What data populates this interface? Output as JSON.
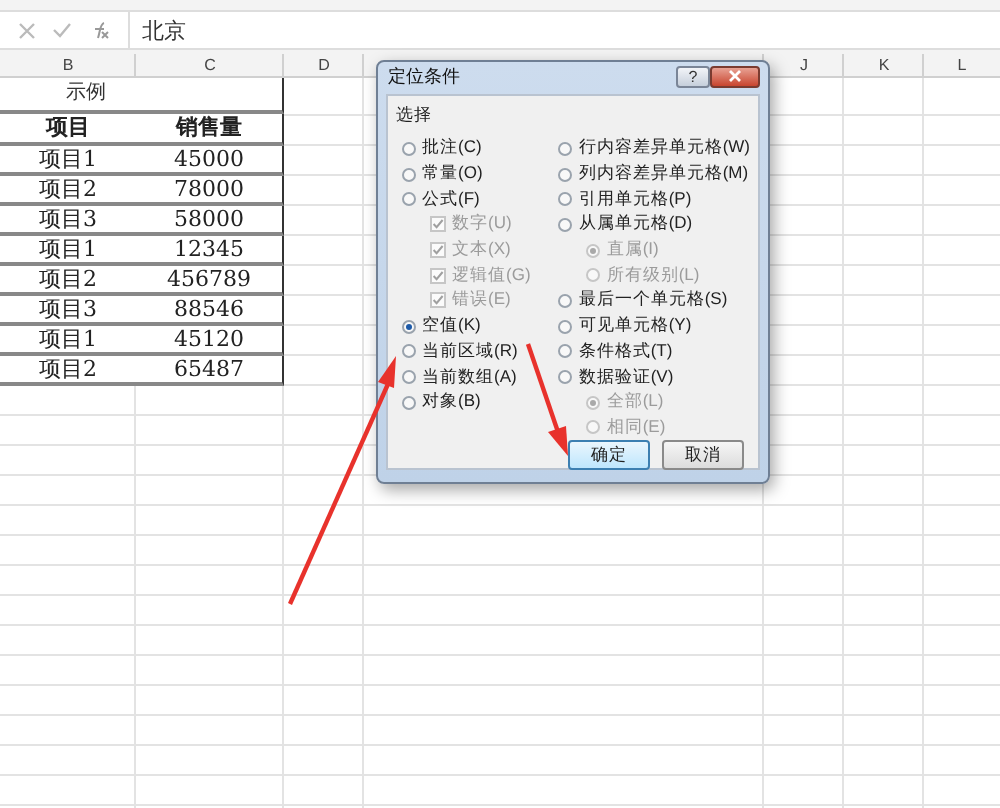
{
  "formula_bar": {
    "value": "北京"
  },
  "sheet": {
    "columns": [
      "B",
      "C",
      "D",
      "J",
      "K",
      "L"
    ],
    "title": "示例",
    "header": [
      "项目",
      "销售量"
    ],
    "rows": [
      [
        "项目1",
        "45000"
      ],
      [
        "项目2",
        "78000"
      ],
      [
        "项目3",
        "58000"
      ],
      [
        "项目1",
        "12345"
      ],
      [
        "项目2",
        "456789"
      ],
      [
        "项目3",
        "88546"
      ],
      [
        "项目1",
        "45120"
      ],
      [
        "项目2",
        "65487"
      ]
    ]
  },
  "dialog": {
    "title": "定位条件",
    "help": "?",
    "group": "选择",
    "left": [
      {
        "kind": "radio",
        "label": "批注(C)",
        "selected": false,
        "disabled": false
      },
      {
        "kind": "radio",
        "label": "常量(O)",
        "selected": false,
        "disabled": false
      },
      {
        "kind": "radio",
        "label": "公式(F)",
        "selected": false,
        "disabled": false,
        "children": [
          {
            "kind": "checkbox",
            "label": "数字(U)",
            "checked": true,
            "disabled": true
          },
          {
            "kind": "checkbox",
            "label": "文本(X)",
            "checked": true,
            "disabled": true
          },
          {
            "kind": "checkbox",
            "label": "逻辑值(G)",
            "checked": true,
            "disabled": true
          },
          {
            "kind": "checkbox",
            "label": "错误(E)",
            "checked": true,
            "disabled": true
          }
        ]
      },
      {
        "kind": "radio",
        "label": "空值(K)",
        "selected": true,
        "disabled": false
      },
      {
        "kind": "radio",
        "label": "当前区域(R)",
        "selected": false,
        "disabled": false
      },
      {
        "kind": "radio",
        "label": "当前数组(A)",
        "selected": false,
        "disabled": false
      },
      {
        "kind": "radio",
        "label": "对象(B)",
        "selected": false,
        "disabled": false
      }
    ],
    "right": [
      {
        "kind": "radio",
        "label": "行内容差异单元格(W)",
        "selected": false,
        "disabled": false
      },
      {
        "kind": "radio",
        "label": "列内容差异单元格(M)",
        "selected": false,
        "disabled": false
      },
      {
        "kind": "radio",
        "label": "引用单元格(P)",
        "selected": false,
        "disabled": false
      },
      {
        "kind": "radio",
        "label": "从属单元格(D)",
        "selected": false,
        "disabled": false,
        "children": [
          {
            "kind": "radio",
            "label": "直属(I)",
            "selected": true,
            "disabled": true
          },
          {
            "kind": "radio",
            "label": "所有级别(L)",
            "selected": false,
            "disabled": true
          }
        ]
      },
      {
        "kind": "radio",
        "label": "最后一个单元格(S)",
        "selected": false,
        "disabled": false
      },
      {
        "kind": "radio",
        "label": "可见单元格(Y)",
        "selected": false,
        "disabled": false
      },
      {
        "kind": "radio",
        "label": "条件格式(T)",
        "selected": false,
        "disabled": false
      },
      {
        "kind": "radio",
        "label": "数据验证(V)",
        "selected": false,
        "disabled": false,
        "children": [
          {
            "kind": "radio",
            "label": "全部(L)",
            "selected": true,
            "disabled": true
          },
          {
            "kind": "radio",
            "label": "相同(E)",
            "selected": false,
            "disabled": true
          }
        ]
      }
    ],
    "buttons": [
      "确定",
      "取消"
    ]
  }
}
